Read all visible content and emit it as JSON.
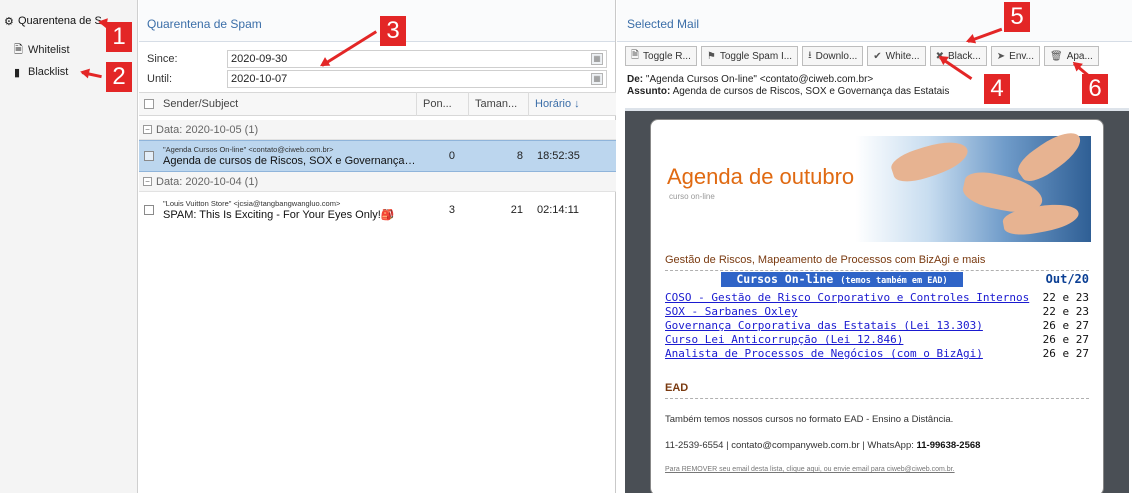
{
  "nav": {
    "root": "Quarentena de S",
    "items": [
      {
        "label": "Whitelist"
      },
      {
        "label": "Blacklist"
      }
    ]
  },
  "spam_pane": {
    "title": "Quarentena de Spam",
    "since_label": "Since:",
    "since_value": "2020-09-30",
    "until_label": "Until:",
    "until_value": "2020-10-07",
    "columns": [
      "Sender/Subject",
      "Pon...",
      "Taman...",
      "Horário ↓"
    ],
    "groups": [
      {
        "label": "Data: 2020-10-05 (1)",
        "rows": [
          {
            "from": "\"Agenda Cursos On-line\" <contato@ciweb.com.br>",
            "subject": "Agenda de cursos de Riscos, SOX e Governança das Estatais",
            "score": "0",
            "size": "8",
            "time": "18:52:35"
          }
        ]
      },
      {
        "label": "Data: 2020-10-04 (1)",
        "rows": [
          {
            "from": "\"Louis Vuitton Store\" <jcsia@tangbangwangluo.com>",
            "subject": "SPAM: This Is Exciting - For Your Eyes Only!🎒",
            "score": "3",
            "size": "21",
            "time": "02:14:11"
          }
        ]
      }
    ]
  },
  "mail_pane": {
    "title": "Selected Mail",
    "toolbar": [
      {
        "label": "Toggle R...",
        "icon": "doc-icon"
      },
      {
        "label": "Toggle Spam I...",
        "icon": "flag-icon"
      },
      {
        "label": "Downlo...",
        "icon": "download-icon"
      },
      {
        "label": "White...",
        "icon": "check-icon"
      },
      {
        "label": "Black...",
        "icon": "x-icon"
      },
      {
        "label": "Env...",
        "icon": "send-icon"
      },
      {
        "label": "Apa...",
        "icon": "trash-icon"
      }
    ],
    "de_label": "De:",
    "de_value": "\"Agenda Cursos On-line\" <contato@ciweb.com.br>",
    "assunto_label": "Assunto:",
    "assunto_value": "Agenda de cursos de Riscos, SOX e Governança das Estatais"
  },
  "email_body": {
    "hero_title": "Agenda de outubro",
    "hero_sub": "curso on-line",
    "section1": "Gestão de Riscos, Mapeamento de Processos com BizAgi e mais",
    "table_head": "Cursos On-line",
    "table_head_small": "(temos também em EAD)",
    "table_head_right": "Out/20",
    "courses": [
      {
        "name": "COSO - Gestão de Risco Corporativo e Controles Internos",
        "dates": "22 e 23"
      },
      {
        "name": "SOX - Sarbanes Oxley",
        "dates": "22 e 23"
      },
      {
        "name": "Governança Corporativa das Estatais (Lei 13.303)",
        "dates": "26 e 27"
      },
      {
        "name": "Curso Lei Anticorrupção (Lei 12.846)",
        "dates": "26 e 27"
      },
      {
        "name": "Analista de Processos de Negócios (com o BizAgi)",
        "dates": "26 e 27"
      }
    ],
    "section2": "EAD",
    "ead_text": "Também temos nossos cursos no formato EAD - Ensino a Distância.",
    "contact_text": "11-2539-6554 | contato@companyweb.com.br | WhatsApp:",
    "contact_whatsapp": "11-99638-2568",
    "remove_text": "Para REMOVER seu email desta lista, clique aqui, ou envie email para ciweb@ciweb.com.br."
  },
  "annotations": {
    "color": "#e32626",
    "labels": [
      "1",
      "2",
      "3",
      "4",
      "5",
      "6"
    ]
  }
}
